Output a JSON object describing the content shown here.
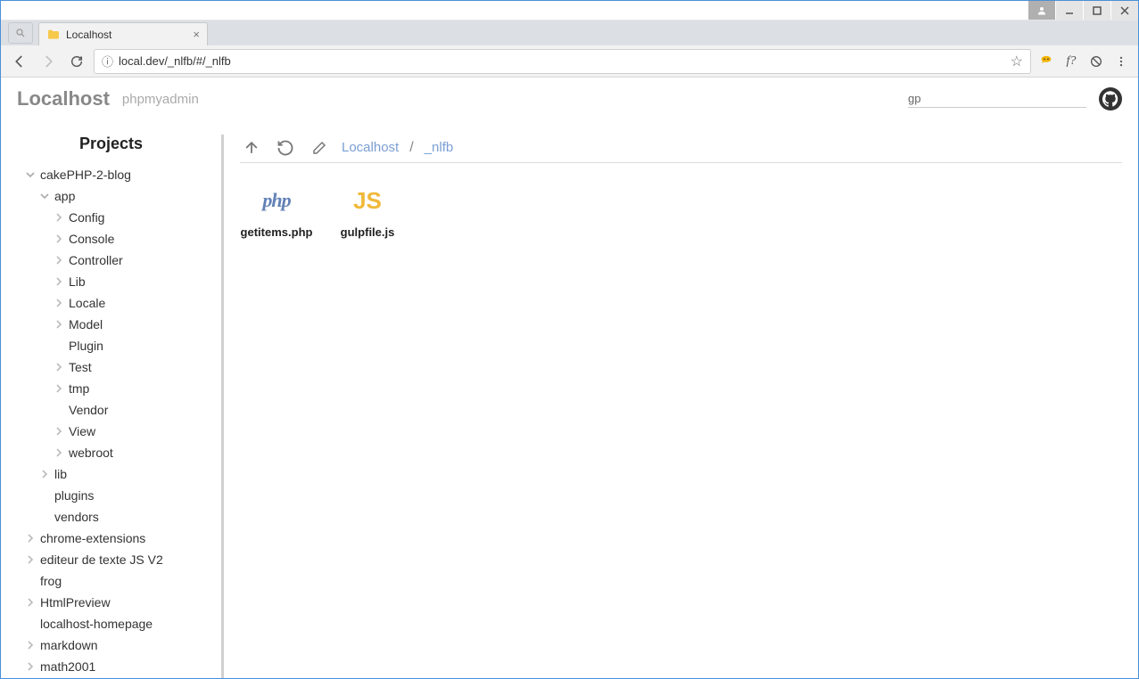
{
  "window": {
    "tab_title": "Localhost",
    "url": "local.dev/_nlfb/#/_nlfb"
  },
  "header": {
    "title": "Localhost",
    "subtitle": "phpmyadmin",
    "search_value": "gp"
  },
  "sidebar": {
    "title": "Projects",
    "items": [
      {
        "label": "cakePHP-2-blog",
        "indent": 0,
        "expandable": true,
        "open": true
      },
      {
        "label": "app",
        "indent": 1,
        "expandable": true,
        "open": true
      },
      {
        "label": "Config",
        "indent": 2,
        "expandable": true,
        "open": false
      },
      {
        "label": "Console",
        "indent": 2,
        "expandable": true,
        "open": false
      },
      {
        "label": "Controller",
        "indent": 2,
        "expandable": true,
        "open": false
      },
      {
        "label": "Lib",
        "indent": 2,
        "expandable": true,
        "open": false
      },
      {
        "label": "Locale",
        "indent": 2,
        "expandable": true,
        "open": false
      },
      {
        "label": "Model",
        "indent": 2,
        "expandable": true,
        "open": false
      },
      {
        "label": "Plugin",
        "indent": 2,
        "expandable": false,
        "open": false
      },
      {
        "label": "Test",
        "indent": 2,
        "expandable": true,
        "open": false
      },
      {
        "label": "tmp",
        "indent": 2,
        "expandable": true,
        "open": false
      },
      {
        "label": "Vendor",
        "indent": 2,
        "expandable": false,
        "open": false
      },
      {
        "label": "View",
        "indent": 2,
        "expandable": true,
        "open": false
      },
      {
        "label": "webroot",
        "indent": 2,
        "expandable": true,
        "open": false
      },
      {
        "label": "lib",
        "indent": 1,
        "expandable": true,
        "open": false
      },
      {
        "label": "plugins",
        "indent": 1,
        "expandable": false,
        "open": false
      },
      {
        "label": "vendors",
        "indent": 1,
        "expandable": false,
        "open": false
      },
      {
        "label": "chrome-extensions",
        "indent": 0,
        "expandable": true,
        "open": false
      },
      {
        "label": "editeur de texte JS V2",
        "indent": 0,
        "expandable": true,
        "open": false
      },
      {
        "label": "frog",
        "indent": 0,
        "expandable": false,
        "open": false
      },
      {
        "label": "HtmlPreview",
        "indent": 0,
        "expandable": true,
        "open": false
      },
      {
        "label": "localhost-homepage",
        "indent": 0,
        "expandable": false,
        "open": false
      },
      {
        "label": "markdown",
        "indent": 0,
        "expandable": true,
        "open": false
      },
      {
        "label": "math2001",
        "indent": 0,
        "expandable": true,
        "open": false
      }
    ]
  },
  "breadcrumb": {
    "root": "Localhost",
    "current": "_nlfb",
    "sep": "/"
  },
  "files": [
    {
      "name": "getitems.php",
      "type": "php",
      "icon_text": "php",
      "highlight_indices": [
        0,
        9
      ]
    },
    {
      "name": "gulpfile.js",
      "type": "js",
      "icon_text": "JS",
      "highlight_indices": [
        0,
        3
      ]
    }
  ]
}
